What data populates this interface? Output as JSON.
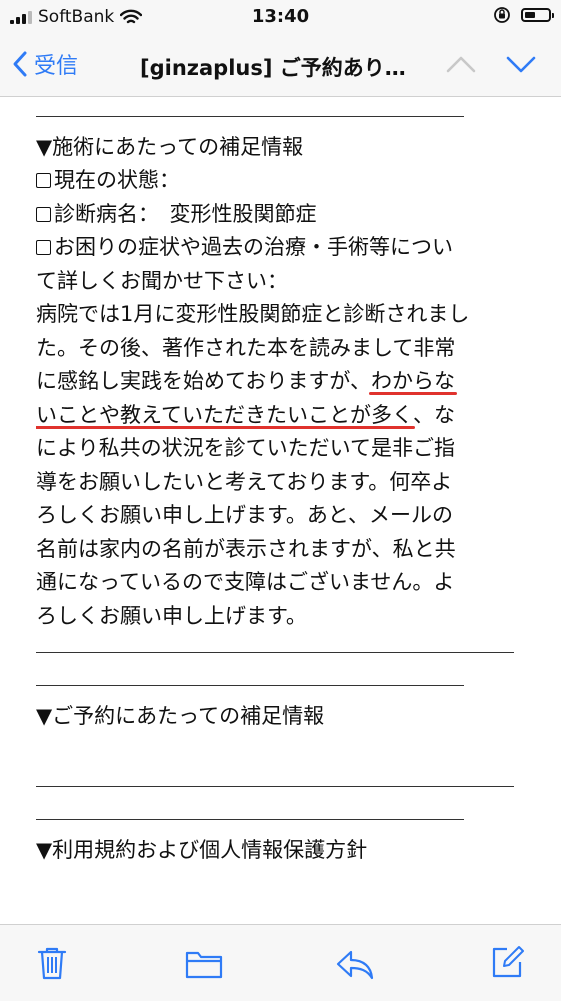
{
  "status": {
    "carrier": "SoftBank",
    "time": "13:40"
  },
  "nav": {
    "back_label": "受信",
    "title": "[ginzaplus] ご予約あり…"
  },
  "body": {
    "section1_heading": "▼施術にあたっての補足情報",
    "field_state": "現在の状態：",
    "field_diagnosis": "診断病名：　変形性股関節症",
    "field_symptoms_1": "お困りの症状や過去の治療・手術等につい",
    "field_symptoms_2": "て詳しくお聞かせ下さい：",
    "p1": "病院では1月に変形性股関節症と診断されまし",
    "p2": "た。その後、著作された本を読みまして非常",
    "p3a": "に感銘し実践を始めておりますが、",
    "p3b": "わからな",
    "p4a": "いことや教えていただきたいことが多く",
    "p4b": "、な",
    "p5": "により私共の状況を診ていただいて是非ご指",
    "p6": "導をお願いしたいと考えております。何卒よ",
    "p7": "ろしくお願い申し上げます。あと、メールの",
    "p8": "名前は家内の名前が表示されますが、私と共",
    "p9": "通になっているので支障はございません。よ",
    "p10": "ろしくお願い申し上げます。",
    "section2_heading": "▼ご予約にあたっての補足情報",
    "section3_heading": "▼利用規約および個人情報保護方針"
  },
  "colors": {
    "accent": "#2f7bf6",
    "underline": "#e0322d"
  },
  "icons": {
    "wifi": "wifi-icon",
    "rotation_lock": "rotation-lock-icon",
    "battery": "battery-icon",
    "back": "chevron-left-icon",
    "up": "chevron-up-icon",
    "down": "chevron-down-icon",
    "trash": "trash-icon",
    "folder": "folder-icon",
    "reply": "reply-icon",
    "compose": "compose-icon"
  }
}
